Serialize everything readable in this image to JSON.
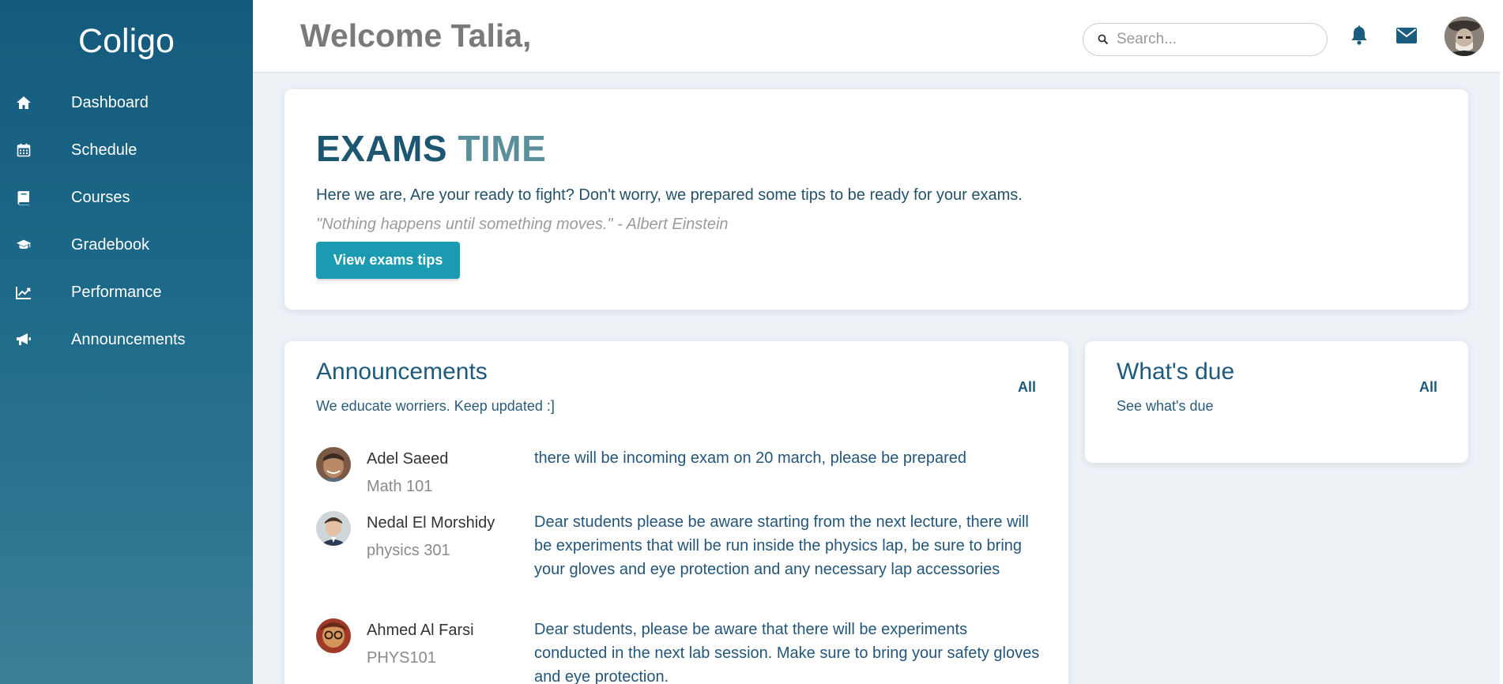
{
  "sidebar": {
    "brand": "Coligo",
    "items": [
      {
        "label": "Dashboard",
        "icon": "home-icon"
      },
      {
        "label": "Schedule",
        "icon": "calendar-icon"
      },
      {
        "label": "Courses",
        "icon": "book-icon"
      },
      {
        "label": "Gradebook",
        "icon": "graduation-cap-icon"
      },
      {
        "label": "Performance",
        "icon": "line-chart-icon"
      },
      {
        "label": "Announcements",
        "icon": "megaphone-icon"
      }
    ]
  },
  "header": {
    "welcome": "Welcome Talia,",
    "search_placeholder": "Search...",
    "icons": [
      "search-icon",
      "bell-icon",
      "mail-icon",
      "avatar"
    ]
  },
  "exams": {
    "title_part1": "EXAMS",
    "title_part2": "TIME",
    "description": "Here we are, Are your ready to fight? Don't worry, we prepared some tips to be ready for your exams.",
    "quote": "\"Nothing happens until something moves.\" - Albert Einstein",
    "button": "View exams tips"
  },
  "announcements": {
    "title": "Announcements",
    "subtitle": "We educate worriers. Keep updated :]",
    "all_link": "All",
    "items": [
      {
        "name": "Adel Saeed",
        "course": "Math 101",
        "message": "there will be incoming exam on 20 march, please be prepared"
      },
      {
        "name": "Nedal El Morshidy",
        "course": "physics 301",
        "message": "Dear students please be aware starting from the next lecture, there will be experiments that will be run inside the physics lap, be sure to bring your gloves and eye protection and any necessary lap accessories"
      },
      {
        "name": "Ahmed Al Farsi",
        "course": "PHYS101",
        "message": "Dear students, please be aware that there will be experiments conducted in the next lab session. Make sure to bring your safety gloves and eye protection."
      }
    ]
  },
  "whats_due": {
    "title": "What's due",
    "subtitle": "See what's due",
    "all_link": "All"
  },
  "colors": {
    "sidebar_top": "#145a7c",
    "sidebar_bottom": "#3a7f95",
    "accent_button": "#1b9bb1",
    "heading": "#1d5a7d"
  }
}
